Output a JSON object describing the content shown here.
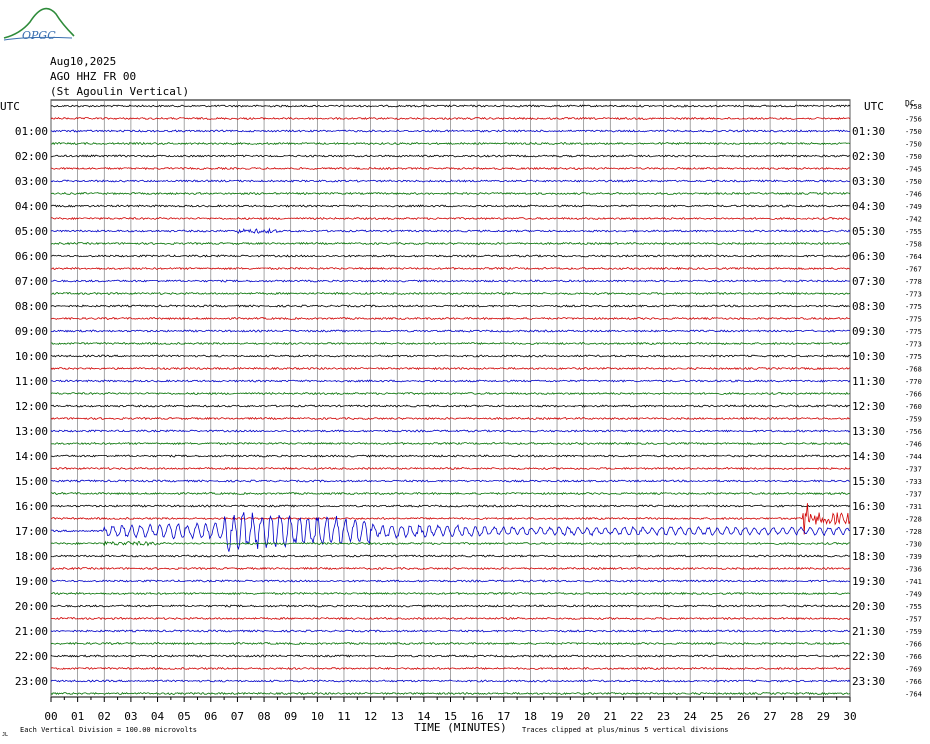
{
  "logo": {
    "text": "OPGC"
  },
  "header": {
    "date": "Aug10,2025",
    "channel": "AGO HHZ FR 00",
    "station": "(St Agoulin Vertical)"
  },
  "chart_data": {
    "type": "line",
    "xlabel": "TIME (MINUTES)",
    "left_axis_label": "UTC",
    "right_axis_label": "UTC",
    "dc_label": "DC",
    "x_ticks": [
      "00",
      "01",
      "02",
      "03",
      "04",
      "05",
      "06",
      "07",
      "08",
      "09",
      "10",
      "11",
      "12",
      "13",
      "14",
      "15",
      "16",
      "17",
      "18",
      "19",
      "20",
      "21",
      "22",
      "23",
      "24",
      "25",
      "26",
      "27",
      "28",
      "29",
      "30"
    ],
    "xlim": [
      0,
      30
    ],
    "left_hour_labels": [
      "01:00",
      "02:00",
      "03:00",
      "04:00",
      "05:00",
      "06:00",
      "07:00",
      "08:00",
      "09:00",
      "10:00",
      "11:00",
      "12:00",
      "13:00",
      "14:00",
      "15:00",
      "16:00",
      "17:00",
      "18:00",
      "19:00",
      "20:00",
      "21:00",
      "22:00",
      "23:00"
    ],
    "right_hour_labels": [
      "01:30",
      "02:30",
      "03:30",
      "04:30",
      "05:30",
      "06:30",
      "07:30",
      "08:30",
      "09:30",
      "10:30",
      "11:30",
      "12:30",
      "13:30",
      "14:30",
      "15:30",
      "16:30",
      "17:30",
      "18:30",
      "19:30",
      "20:30",
      "21:30",
      "22:30",
      "23:30"
    ],
    "trace_colors": [
      "#000000",
      "#d00000",
      "#0000c8",
      "#007000"
    ],
    "dc_offsets": [
      "-758",
      "-756",
      "-750",
      "-750",
      "-750",
      "-745",
      "-750",
      "-746",
      "-749",
      "-742",
      "-755",
      "-758",
      "-764",
      "-767",
      "-778",
      "-773",
      "-775",
      "-775",
      "-775",
      "-773",
      "-775",
      "-768",
      "-770",
      "-766",
      "-760",
      "-759",
      "-756",
      "-746",
      "-744",
      "-737",
      "-733",
      "-737",
      "-731",
      "-728",
      "-728",
      "-730",
      "-739",
      "-736",
      "-741",
      "-749",
      "-755",
      "-757",
      "-759",
      "-766",
      "-766",
      "-769",
      "-766",
      "-764"
    ],
    "events": [
      {
        "start_min": 2.0,
        "end_min": 30.0,
        "trace_hour": "17:00",
        "description": "large regional event on blue trace"
      },
      {
        "start_min": 28.2,
        "end_min": 30.0,
        "trace_hour": "16:30",
        "description": "onset on red trace"
      }
    ]
  },
  "footer": {
    "scale_note": "Each Vertical Division =  100.00 microvolts",
    "clip_note": "Traces clipped at plus/minus 5 vertical divisions",
    "corner_mark": "JL"
  }
}
